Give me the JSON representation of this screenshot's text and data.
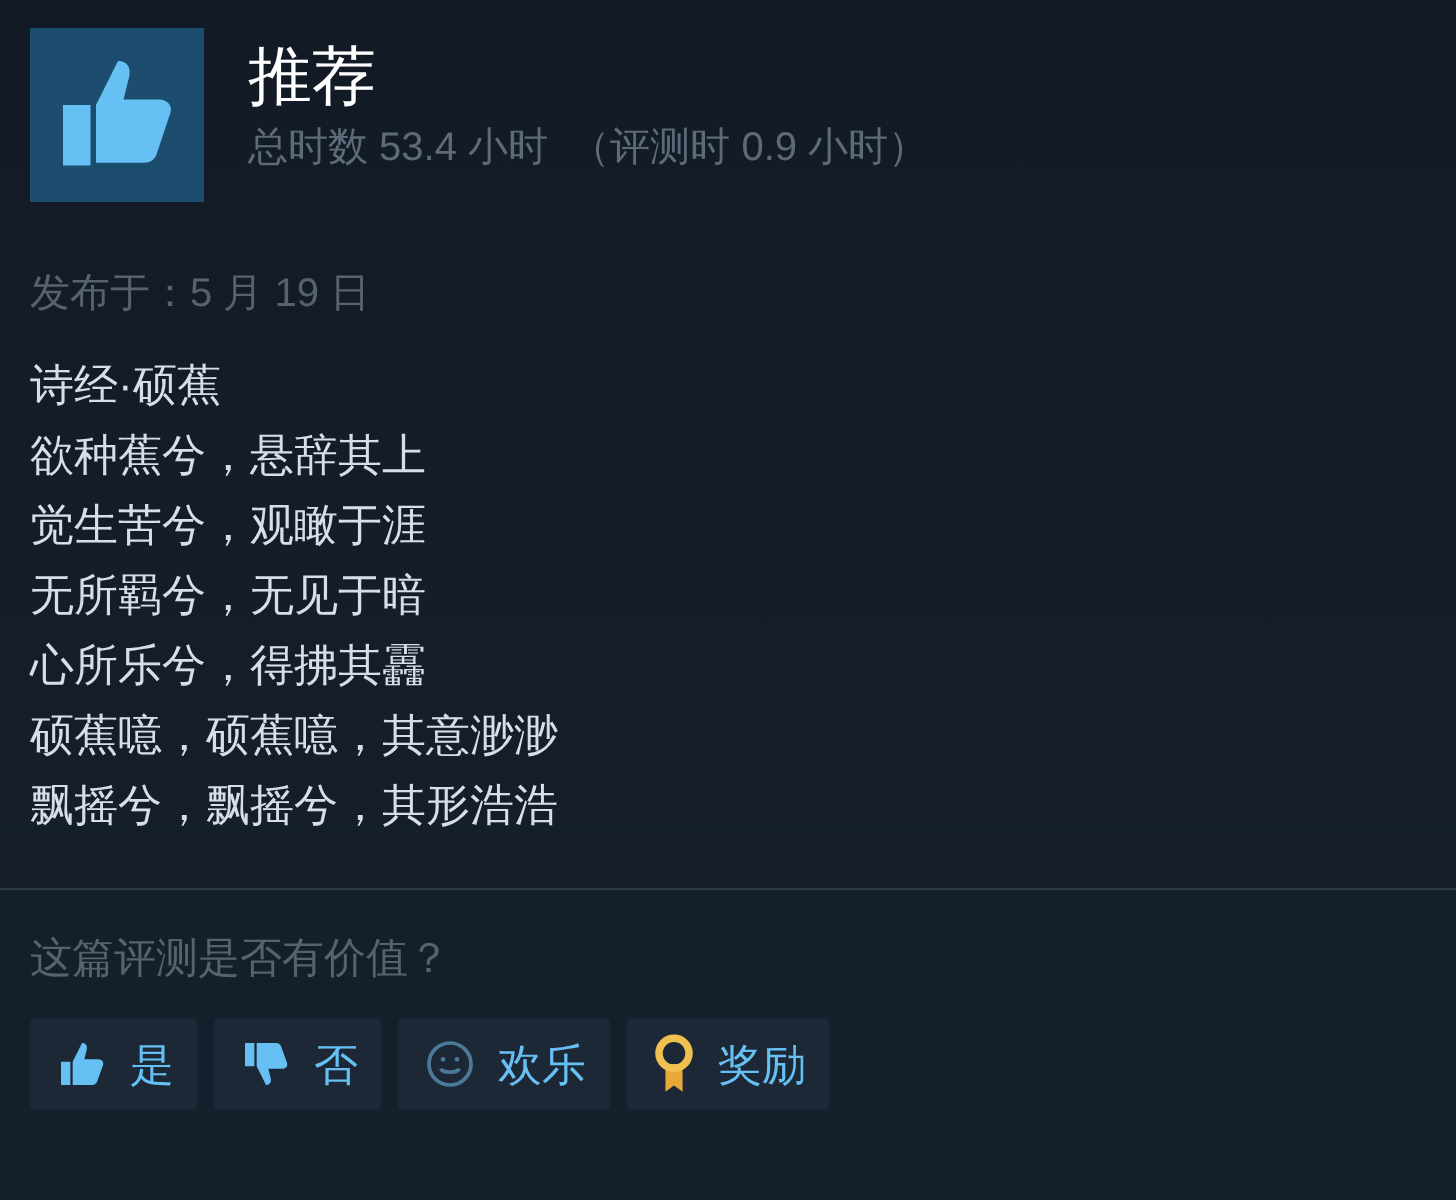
{
  "review": {
    "recommendation": "推荐",
    "hours": "总时数 53.4 小时  （评测时 0.9 小时）",
    "posted": "发布于：5 月 19 日",
    "lines": [
      "诗经·硕蕉",
      "欲种蕉兮，悬辞其上",
      "觉生苦兮，观瞰于涯",
      "无所羁兮，无见于暗",
      "心所乐兮，得拂其靐",
      "硕蕉噫，硕蕉噫，其意渺渺",
      "飘摇兮，飘摇兮，其形浩浩"
    ]
  },
  "helpful": {
    "question": "这篇评测是否有价值？",
    "buttons": [
      {
        "label": "是",
        "kind": "yes"
      },
      {
        "label": "否",
        "kind": "no"
      },
      {
        "label": "欢乐",
        "kind": "funny"
      },
      {
        "label": "奖励",
        "kind": "award"
      }
    ]
  }
}
